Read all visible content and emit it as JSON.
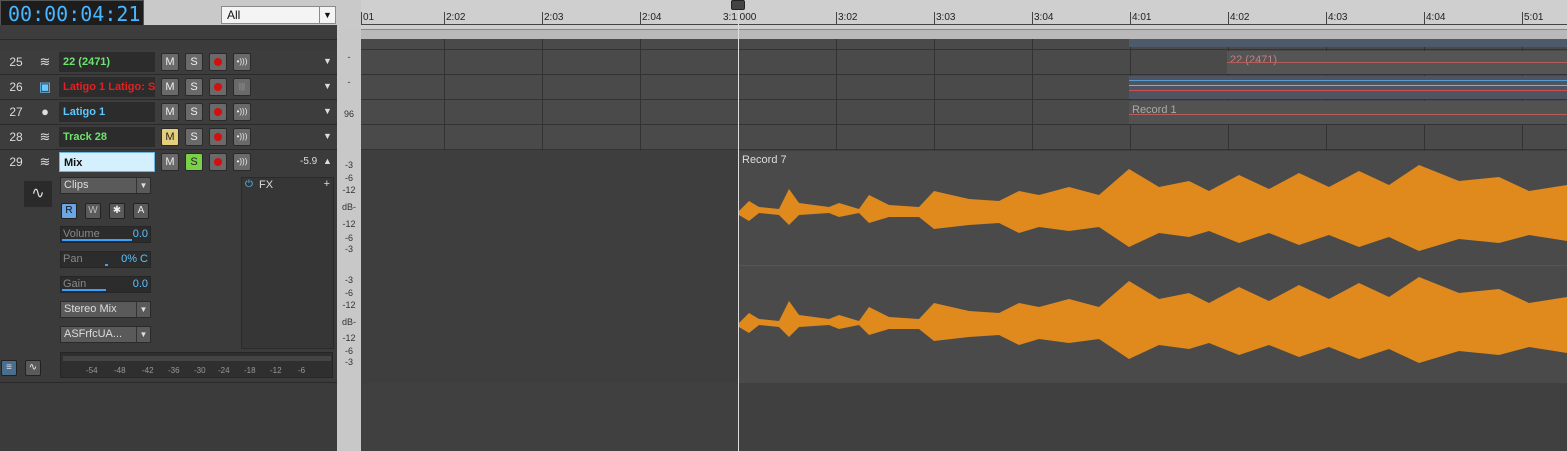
{
  "transport": {
    "time": "00:00:04:21",
    "filter_value": "All"
  },
  "ruler": {
    "marks": [
      "01",
      "2:02",
      "2:03",
      "2:04",
      "3:1:000",
      "3:02",
      "3:03",
      "3:04",
      "4:01",
      "4:02",
      "4:03",
      "4:04",
      "5:01"
    ]
  },
  "tracks": [
    {
      "num": "25",
      "name": "22 (2471)",
      "name_color": "#6fe36f",
      "icon": "audio-wave-icon"
    },
    {
      "num": "26",
      "name": "Latigo 1 Latigo: S",
      "name_color": "#e62020",
      "icon": "synth-icon"
    },
    {
      "num": "27",
      "name": "Latigo 1",
      "name_color": "#5bc8ff",
      "icon": "midi-icon"
    },
    {
      "num": "28",
      "name": "Track 28",
      "name_color": "#6fe36f",
      "icon": "audio-wave-icon"
    },
    {
      "num": "29",
      "name": "Mix",
      "name_color": "#111111",
      "icon": "audio-wave-icon"
    }
  ],
  "buttons": {
    "mute": "M",
    "solo": "S"
  },
  "mix": {
    "volume_db": "-5.9",
    "clips_label": "Clips",
    "fx_label": "FX",
    "read": "R",
    "write": "W",
    "automation": "A",
    "volume_label": "Volume",
    "volume_val": "0.0",
    "pan_label": "Pan",
    "pan_val": "0% C",
    "gain_label": "Gain",
    "gain_val": "0.0",
    "output": "Stereo Mix",
    "input": "ASFrfcUA...",
    "meter_labels": [
      "-54",
      "-48",
      "-42",
      "-36",
      "-30",
      "-24",
      "-18",
      "-12",
      "-6"
    ]
  },
  "scale": {
    "s96": "96",
    "m3": "-3",
    "m6": "-6",
    "m12": "-12",
    "db": "dB-"
  },
  "clips": {
    "c1": "22 (2471)",
    "c2": "Record 1",
    "c3": "Record 7"
  },
  "colors": {
    "waveform": "#e08a1e",
    "accent": "#4ab6ff"
  }
}
